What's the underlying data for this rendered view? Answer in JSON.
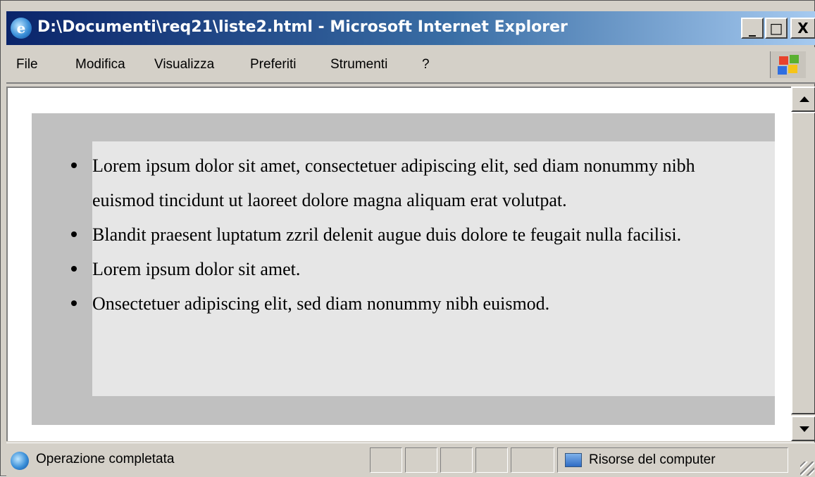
{
  "window": {
    "title": "D:\\Documenti\\req21\\liste2.html - Microsoft Internet Explorer",
    "buttons": {
      "minimize": "_",
      "maximize": "□",
      "close": "X"
    }
  },
  "menu": {
    "items": [
      "File",
      "Modifica",
      "Visualizza",
      "Preferiti",
      "Strumenti",
      "?"
    ]
  },
  "content": {
    "list": [
      "Lorem ipsum dolor sit amet, consectetuer adipiscing elit, sed diam nonummy nibh euismod tincidunt ut laoreet dolore magna aliquam erat volutpat.",
      "Blandit praesent luptatum zzril delenit augue duis dolore te feugait nulla facilisi.",
      "Lorem ipsum dolor sit amet.",
      "Onsectetuer adipiscing elit, sed diam nonummy nibh euismod."
    ]
  },
  "statusbar": {
    "status": "Operazione completata",
    "zone": "Risorse del computer"
  },
  "icons": {
    "title": "ie-icon",
    "logo": "windows-logo-icon",
    "status": "ie-page-icon",
    "zone": "computer-icon"
  },
  "colors": {
    "outer_box": "#c0c0c0",
    "inner_box": "#e6e6e6",
    "titlebar_start": "#0a246a",
    "titlebar_end": "#a6caf0"
  }
}
